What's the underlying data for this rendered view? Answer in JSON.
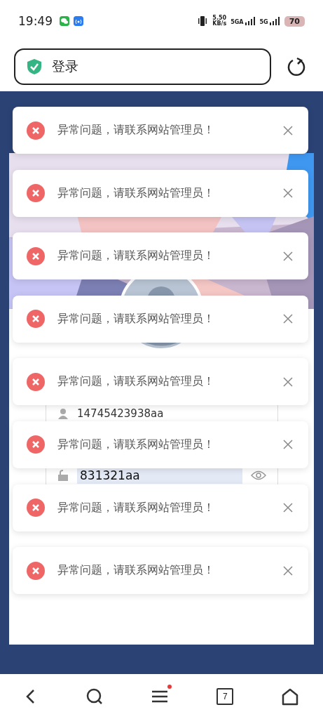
{
  "status_bar": {
    "time": "19:49",
    "speed": "5.50",
    "speed_unit": "KB/s",
    "network_1": "5GA",
    "network_2": "5G",
    "battery": "70"
  },
  "address_bar": {
    "title": "登录"
  },
  "login_form": {
    "username": "14745423938aa",
    "password": "831321aa"
  },
  "toasts": [
    {
      "message": "异常问题，请联系网站管理员！"
    },
    {
      "message": "异常问题，请联系网站管理员！"
    },
    {
      "message": "异常问题，请联系网站管理员！"
    },
    {
      "message": "异常问题，请联系网站管理员！"
    },
    {
      "message": "异常问题，请联系网站管理员！"
    },
    {
      "message": "异常问题，请联系网站管理员！"
    },
    {
      "message": "异常问题，请联系网站管理员！"
    },
    {
      "message": "异常问题，请联系网站管理员！"
    }
  ],
  "bottom_nav": {
    "tab_count": "7",
    "menu_badge": true
  }
}
